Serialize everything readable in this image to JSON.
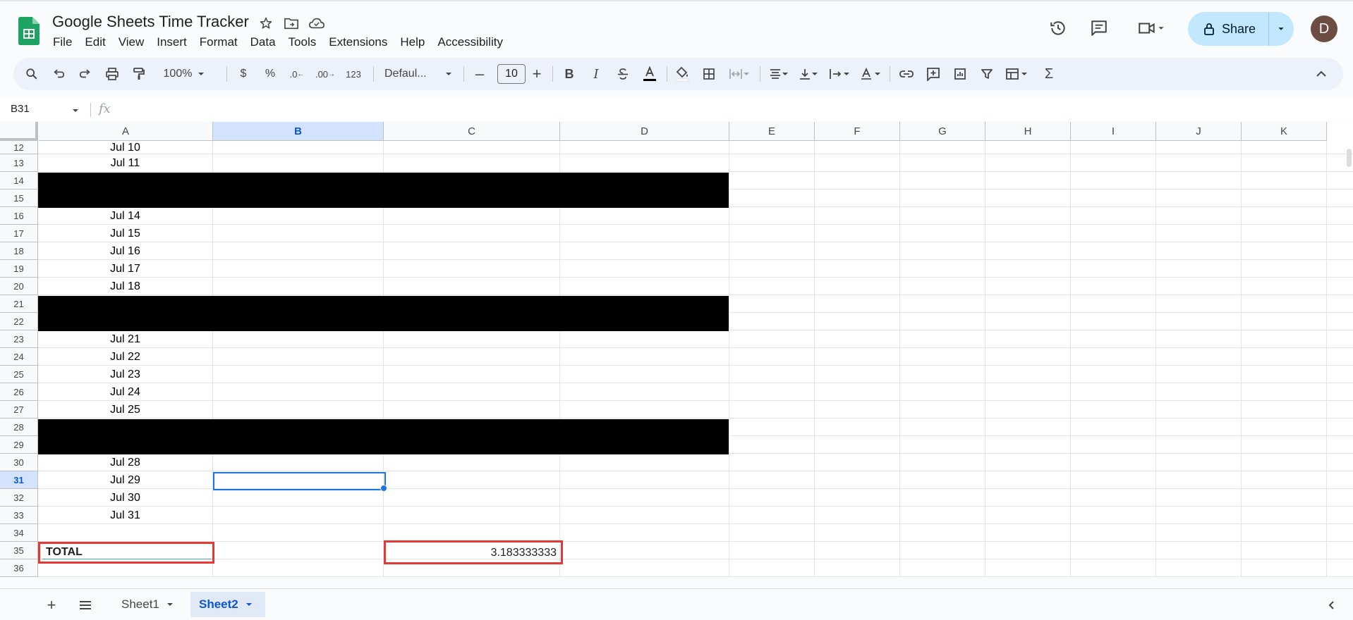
{
  "doc": {
    "title": "Google Sheets Time Tracker"
  },
  "menu": [
    "File",
    "Edit",
    "View",
    "Insert",
    "Format",
    "Data",
    "Tools",
    "Extensions",
    "Help",
    "Accessibility"
  ],
  "header": {
    "share_label": "Share",
    "avatar_initial": "D"
  },
  "toolbar": {
    "zoom": "100%",
    "currency": "$",
    "percent": "%",
    "dec_decrease": ".0",
    "dec_increase": ".00",
    "number_format": "123",
    "font": "Defaul...",
    "font_size": "10"
  },
  "formula_bar": {
    "name_box": "B31",
    "fx": "fx",
    "value": ""
  },
  "columns": [
    "A",
    "B",
    "C",
    "D",
    "E",
    "F",
    "G",
    "H",
    "I",
    "J",
    "K"
  ],
  "selected_column": "B",
  "rows": [
    {
      "num": "12",
      "a": "Jul 10"
    },
    {
      "num": "13",
      "a": "Jul 11"
    },
    {
      "num": "14",
      "a": "",
      "redacted": true
    },
    {
      "num": "15",
      "a": "",
      "redacted": true
    },
    {
      "num": "16",
      "a": "Jul 14"
    },
    {
      "num": "17",
      "a": "Jul 15"
    },
    {
      "num": "18",
      "a": "Jul 16"
    },
    {
      "num": "19",
      "a": "Jul 17"
    },
    {
      "num": "20",
      "a": "Jul 18"
    },
    {
      "num": "21",
      "a": "",
      "redacted": true
    },
    {
      "num": "22",
      "a": "",
      "redacted": true
    },
    {
      "num": "23",
      "a": "Jul 21"
    },
    {
      "num": "24",
      "a": "Jul 22"
    },
    {
      "num": "25",
      "a": "Jul 23"
    },
    {
      "num": "26",
      "a": "Jul 24"
    },
    {
      "num": "27",
      "a": "Jul 25"
    },
    {
      "num": "28",
      "a": "",
      "redacted": true
    },
    {
      "num": "29",
      "a": "",
      "redacted": true
    },
    {
      "num": "30",
      "a": "Jul 28"
    },
    {
      "num": "31",
      "a": "Jul 29",
      "selected": true
    },
    {
      "num": "32",
      "a": "Jul 30"
    },
    {
      "num": "33",
      "a": "Jul 31"
    },
    {
      "num": "34",
      "a": ""
    },
    {
      "num": "35",
      "a": "TOTAL",
      "c": "3.183333333"
    },
    {
      "num": "36",
      "a": ""
    }
  ],
  "total": {
    "label": "TOTAL",
    "value": "3.183333333"
  },
  "sheets": [
    {
      "name": "Sheet1",
      "active": false
    },
    {
      "name": "Sheet2",
      "active": true
    }
  ]
}
